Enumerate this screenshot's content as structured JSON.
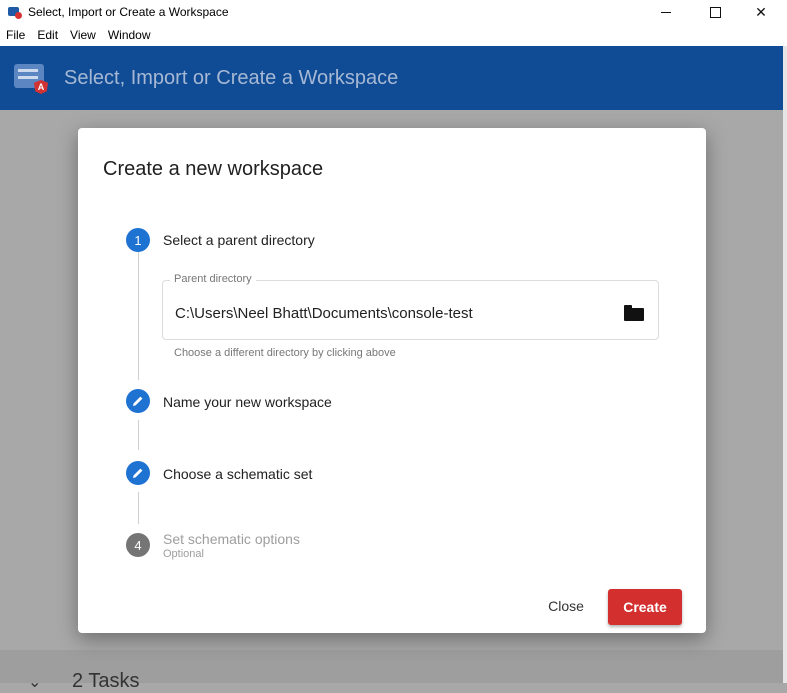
{
  "window": {
    "title": "Select, Import or Create a Workspace",
    "min_icon": "minimize-icon",
    "max_icon": "maximize-icon",
    "close_icon": "close-icon",
    "close_glyph": "✕"
  },
  "menu": [
    "File",
    "Edit",
    "View",
    "Window"
  ],
  "header": {
    "title": "Select, Import or Create a Workspace",
    "logo_letter": "A"
  },
  "dialog": {
    "title": "Create a new workspace",
    "steps": [
      {
        "number": "1",
        "label": "Select a parent directory",
        "icon": "number"
      },
      {
        "number": "",
        "label": "Name your new workspace",
        "icon": "edit-icon"
      },
      {
        "number": "",
        "label": "Choose a schematic set",
        "icon": "edit-icon"
      },
      {
        "number": "4",
        "label": "Set schematic options",
        "sub": "Optional",
        "icon": "number"
      }
    ],
    "parent_directory": {
      "label": "Parent directory",
      "value": "C:\\Users\\Neel Bhatt\\Documents\\console-test",
      "hint": "Choose a different directory by clicking above"
    },
    "buttons": {
      "close": "Close",
      "create": "Create"
    }
  },
  "background": {
    "tasks_label": "2 Tasks",
    "chevron": "⌄"
  },
  "colors": {
    "header": "#0f4c95",
    "step_active": "#1e72d2",
    "step_inactive": "#757575",
    "create_button": "#d32f2f"
  }
}
